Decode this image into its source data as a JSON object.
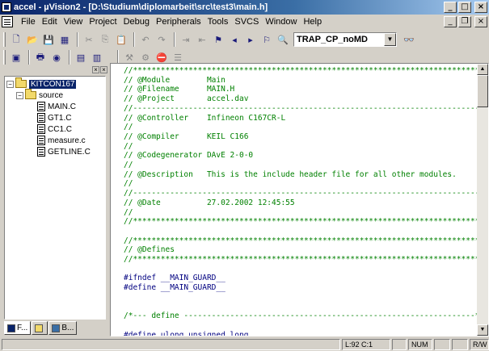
{
  "window": {
    "title": "accel - µVision2 - [D:\\Studium\\diplomarbeit\\src\\test3\\main.h]",
    "controls": {
      "minimize": "_",
      "maximize": "□",
      "close": "×"
    }
  },
  "menu": {
    "items": [
      "File",
      "Edit",
      "View",
      "Project",
      "Debug",
      "Peripherals",
      "Tools",
      "SVCS",
      "Window",
      "Help"
    ],
    "doc_controls": {
      "minimize": "_",
      "restore": "❐",
      "close": "×"
    }
  },
  "toolbar": {
    "target_combo": "TRAP_CP_noMD"
  },
  "project": {
    "header_buttons": [
      "×",
      "×"
    ],
    "target": "KITCON167",
    "group": "source",
    "files": [
      "MAIN.C",
      "GT1.C",
      "CC1.C",
      "measure.c",
      "GETLINE.C"
    ],
    "expander_target": "−",
    "expander_group": "−",
    "tabs": [
      "F...",
      "",
      "B..."
    ]
  },
  "editor": {
    "lines": [
      {
        "t": "//****************************************************************************",
        "c": "cm"
      },
      {
        "t": "// @Module        Main",
        "c": "cm"
      },
      {
        "t": "// @Filename      MAIN.H",
        "c": "cm"
      },
      {
        "t": "// @Project       accel.dav",
        "c": "cm"
      },
      {
        "t": "//----------------------------------------------------------------------------",
        "c": "cm"
      },
      {
        "t": "// @Controller    Infineon C167CR-L",
        "c": "cm"
      },
      {
        "t": "//",
        "c": "cm"
      },
      {
        "t": "// @Compiler      KEIL C166",
        "c": "cm"
      },
      {
        "t": "//",
        "c": "cm"
      },
      {
        "t": "// @Codegenerator DAvE 2-0-0",
        "c": "cm"
      },
      {
        "t": "//",
        "c": "cm"
      },
      {
        "t": "// @Description   This is the include header file for all other modules.",
        "c": "cm"
      },
      {
        "t": "//",
        "c": "cm"
      },
      {
        "t": "//----------------------------------------------------------------------------",
        "c": "cm"
      },
      {
        "t": "// @Date          27.02.2002 12:45:55",
        "c": "cm"
      },
      {
        "t": "//",
        "c": "cm"
      },
      {
        "t": "//****************************************************************************",
        "c": "cm"
      },
      {
        "t": "",
        "c": ""
      },
      {
        "t": "//****************************************************************************",
        "c": "cm"
      },
      {
        "t": "// @Defines",
        "c": "cm"
      },
      {
        "t": "//****************************************************************************",
        "c": "cm"
      },
      {
        "t": "",
        "c": ""
      },
      {
        "t": "#ifndef __MAIN_GUARD__",
        "c": "pp"
      },
      {
        "t": "#define __MAIN_GUARD__",
        "c": "pp"
      },
      {
        "t": "",
        "c": ""
      },
      {
        "t": "",
        "c": ""
      },
      {
        "t": "/*--- define ---------------------------------------------------------------*/",
        "c": "cm"
      },
      {
        "t": "",
        "c": ""
      },
      {
        "t": "#define ulong unsigned long",
        "c": "pp"
      }
    ]
  },
  "status": {
    "position": "L:92 C:1",
    "num": "NUM",
    "rw": "R/W"
  }
}
